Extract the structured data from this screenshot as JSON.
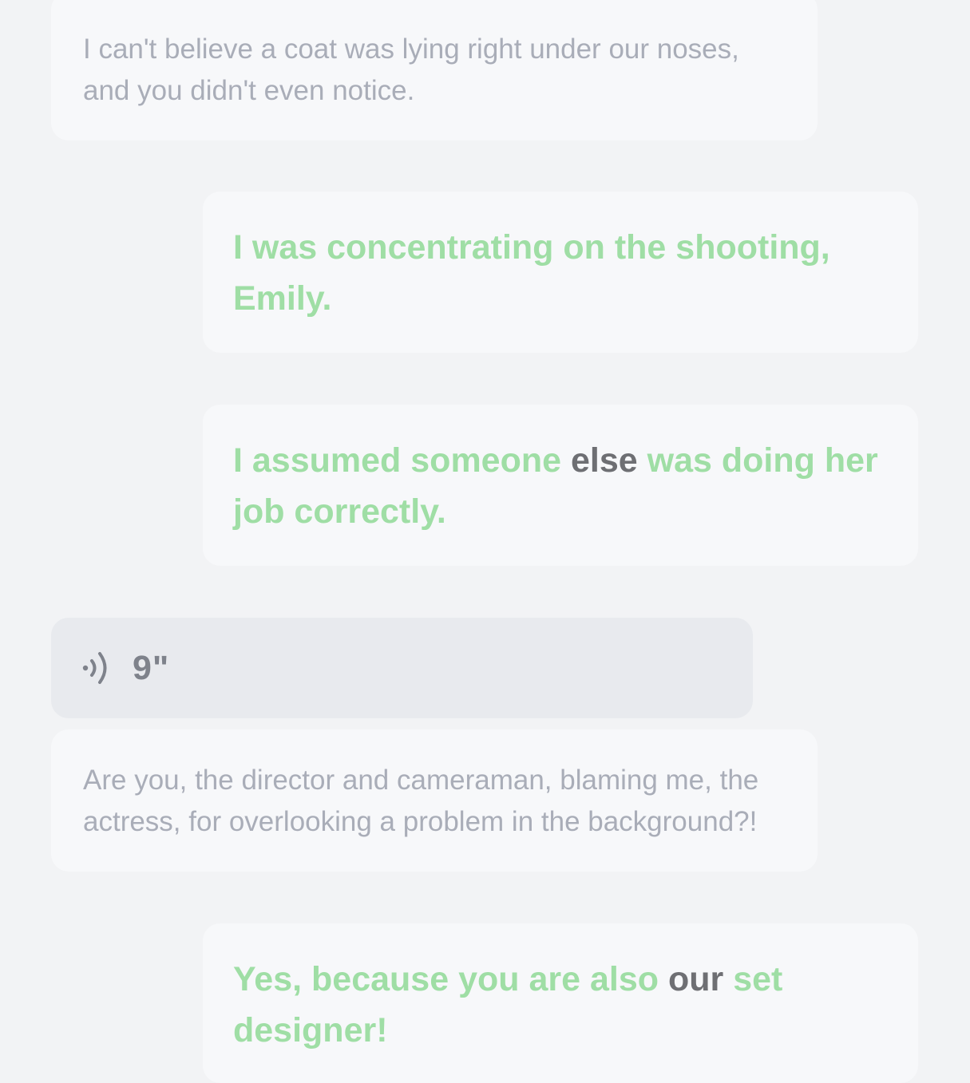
{
  "messages": [
    {
      "side": "incoming",
      "text": "I can't believe a coat was lying right under our noses, and you didn't even notice."
    },
    {
      "side": "outgoing",
      "text": "I was concentrating on the shooting, Emily."
    },
    {
      "side": "outgoing",
      "parts": [
        "I assumed someone ",
        "else",
        " was doing her job correctly."
      ]
    },
    {
      "side": "incoming",
      "type": "voice",
      "icon": "voice-wave-icon",
      "duration": "9\""
    },
    {
      "side": "incoming",
      "text": "Are you, the director and cameraman, blaming me, the actress, for overlooking a problem in the background?!"
    },
    {
      "side": "outgoing",
      "parts": [
        "Yes, because you are also ",
        "our",
        " set designer!"
      ]
    }
  ],
  "colors": {
    "background": "#f2f3f5",
    "bubble": "#f7f8fa",
    "voice_bubble": "#e8eaee",
    "incoming_text": "#a9adb8",
    "outgoing_text": "#9fdea5",
    "highlight_word": "#6e6f73"
  }
}
